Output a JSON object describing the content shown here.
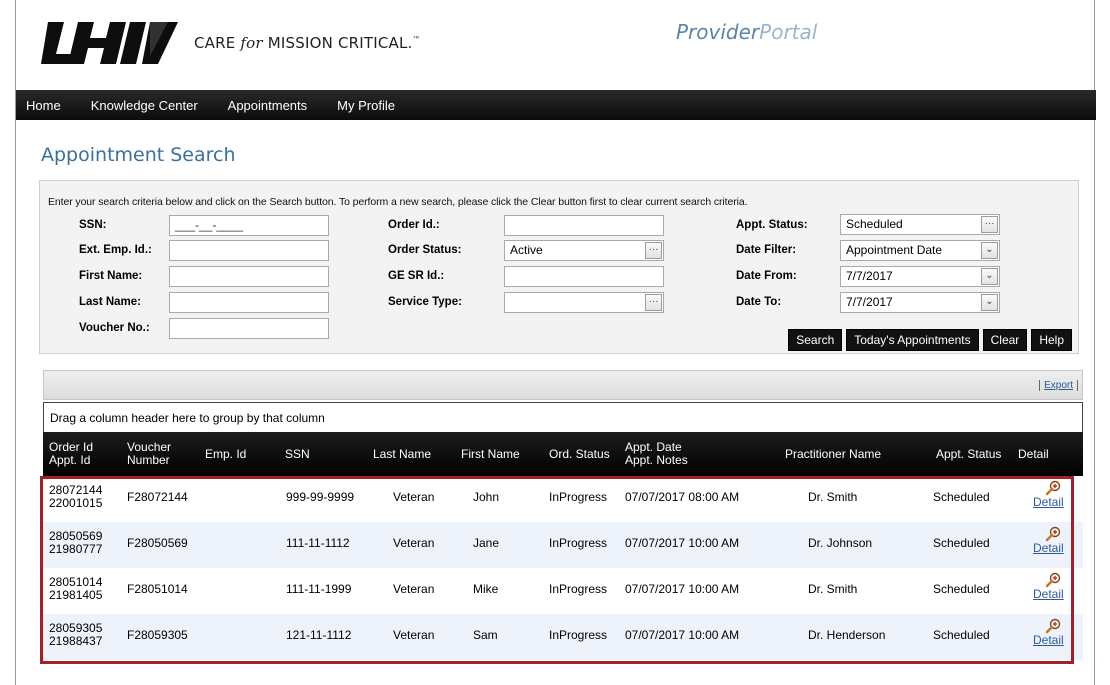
{
  "header": {
    "logo_text": "LHI",
    "tagline_care": "CARE ",
    "tagline_for": "for",
    "tagline_rest": " MISSION CRITICAL.",
    "tagline_tm": "™",
    "portal_part1": "Provider",
    "portal_part2": "Portal"
  },
  "nav": {
    "items": [
      "Home",
      "Knowledge Center",
      "Appointments",
      "My Profile"
    ]
  },
  "page_title": "Appointment Search",
  "search": {
    "instructions": "Enter your search criteria below and click on the Search button. To perform a new search, please click the Clear button first to clear current search criteria.",
    "labels": {
      "ssn": "SSN:",
      "ext_emp_id": "Ext. Emp. Id.:",
      "first_name": "First Name:",
      "last_name": "Last Name:",
      "voucher_no": "Voucher No.:",
      "order_id": "Order Id.:",
      "order_status": "Order Status:",
      "ge_sr_id": "GE SR Id.:",
      "service_type": "Service Type:",
      "appt_status": "Appt. Status:",
      "date_filter": "Date Filter:",
      "date_from": "Date From:",
      "date_to": "Date To:"
    },
    "values": {
      "ssn_mask": "___-__-____",
      "ext_emp_id": "",
      "first_name": "",
      "last_name": "",
      "voucher_no": "",
      "order_id": "",
      "order_status": "Active",
      "ge_sr_id": "",
      "service_type": "",
      "appt_status": "Scheduled",
      "date_filter": "Appointment Date",
      "date_from": "7/7/2017",
      "date_to": "7/7/2017"
    },
    "ellipsis_glyph": "···",
    "chevron_glyph": "⌄",
    "buttons": {
      "search": "Search",
      "today": "Today's Appointments",
      "clear": "Clear",
      "help": "Help"
    }
  },
  "export_label": "Export",
  "grid": {
    "group_hint": "Drag a column header here to group by that column",
    "headers": {
      "order_id": "Order Id",
      "appt_id": "Appt. Id",
      "voucher": "Voucher",
      "number": "Number",
      "emp_id": "Emp. Id",
      "ssn": "SSN",
      "last_name": "Last Name",
      "first_name": "First Name",
      "ord_status": "Ord. Status",
      "appt_date": "Appt. Date",
      "appt_notes": "Appt. Notes",
      "practitioner": "Practitioner Name",
      "appt_status": "Appt. Status",
      "detail": "Detail"
    },
    "rows": [
      {
        "order_id": "28072144",
        "appt_id": "22001015",
        "voucher": "F28072144",
        "emp_id": "",
        "ssn": "999-99-9999",
        "last_name": "Veteran",
        "first_name": "John",
        "ord_status": "InProgress",
        "appt_date": "07/07/2017 08:00 AM",
        "practitioner": "Dr. Smith",
        "appt_status": "Scheduled",
        "detail": "Detail"
      },
      {
        "order_id": "28050569",
        "appt_id": "21980777",
        "voucher": "F28050569",
        "emp_id": "",
        "ssn": "111-11-1112",
        "last_name": "Veteran",
        "first_name": "Jane",
        "ord_status": "InProgress",
        "appt_date": "07/07/2017 10:00 AM",
        "practitioner": "Dr. Johnson",
        "appt_status": "Scheduled",
        "detail": "Detail"
      },
      {
        "order_id": "28051014",
        "appt_id": "21981405",
        "voucher": "F28051014",
        "emp_id": "",
        "ssn": "111-11-1999",
        "last_name": "Veteran",
        "first_name": "Mike",
        "ord_status": "InProgress",
        "appt_date": "07/07/2017 10:00 AM",
        "practitioner": "Dr. Smith",
        "appt_status": "Scheduled",
        "detail": "Detail"
      },
      {
        "order_id": "28059305",
        "appt_id": "21988437",
        "voucher": "F28059305",
        "emp_id": "",
        "ssn": "121-11-1112",
        "last_name": "Veteran",
        "first_name": "Sam",
        "ord_status": "InProgress",
        "appt_date": "07/07/2017 10:00 AM",
        "practitioner": "Dr. Henderson",
        "appt_status": "Scheduled",
        "detail": "Detail"
      }
    ]
  },
  "colors": {
    "nav_bg": "#111111",
    "title_blue": "#3d6f9c",
    "highlight_red": "#a31f2a",
    "link_blue": "#2b5a9c",
    "alt_row": "#eef3fb"
  },
  "icons": {
    "detail": "magnifier-zoom-icon",
    "ellipsis": "ellipsis-icon",
    "dropdown": "chevron-down-icon"
  }
}
